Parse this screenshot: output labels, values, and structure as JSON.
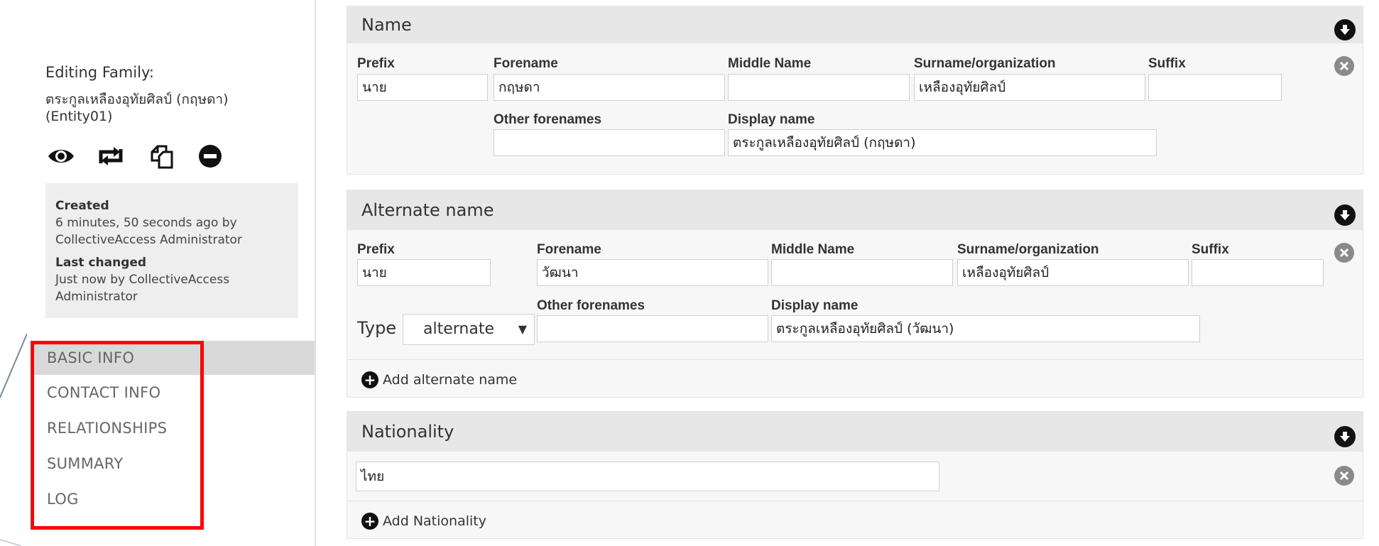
{
  "sidebar": {
    "heading": "Editing Family:",
    "entity_name": "ตระกูลเหลืองอุทัยศิลป์ (กฤษดา) (Entity01)",
    "meta": {
      "created_label": "Created",
      "created_value": "6 minutes, 50 seconds ago by CollectiveAccess Administrator",
      "changed_label": "Last changed",
      "changed_value": "Just now by CollectiveAccess Administrator"
    },
    "nav": [
      {
        "label": "BASIC INFO"
      },
      {
        "label": "CONTACT INFO"
      },
      {
        "label": "RELATIONSHIPS"
      },
      {
        "label": "SUMMARY"
      },
      {
        "label": "LOG"
      }
    ],
    "icons": [
      "eye-icon",
      "retweet-icon",
      "duplicate-icon",
      "delete-icon"
    ]
  },
  "name_bundle": {
    "title": "Name",
    "prefix_label": "Prefix",
    "prefix_value": "นาย",
    "forename_label": "Forename",
    "forename_value": "กฤษดา",
    "middle_label": "Middle Name",
    "middle_value": "",
    "surname_label": "Surname/organization",
    "surname_value": "เหลืองอุทัยศิลป์",
    "suffix_label": "Suffix",
    "suffix_value": "",
    "other_label": "Other forenames",
    "other_value": "",
    "display_label": "Display name",
    "display_value": "ตระกูลเหลืองอุทัยศิลป์ (กฤษดา)"
  },
  "alt_bundle": {
    "title": "Alternate name",
    "prefix_label": "Prefix",
    "prefix_value": "นาย",
    "forename_label": "Forename",
    "forename_value": "วัฒนา",
    "middle_label": "Middle Name",
    "middle_value": "",
    "surname_label": "Surname/organization",
    "surname_value": "เหลืองอุทัยศิลป์",
    "suffix_label": "Suffix",
    "suffix_value": "",
    "type_label": "Type",
    "type_value": "alternate",
    "other_label": "Other forenames",
    "other_value": "",
    "display_label": "Display name",
    "display_value": "ตระกูลเหลืองอุทัยศิลป์ (วัฒนา)",
    "add_label": "Add alternate name"
  },
  "nationality_bundle": {
    "title": "Nationality",
    "value": "ไทย",
    "add_label": "Add Nationality"
  },
  "colors": {
    "highlight": "#ff0000",
    "header_bg": "#e7e7e7",
    "active_nav_bg": "#d9d9d9"
  }
}
